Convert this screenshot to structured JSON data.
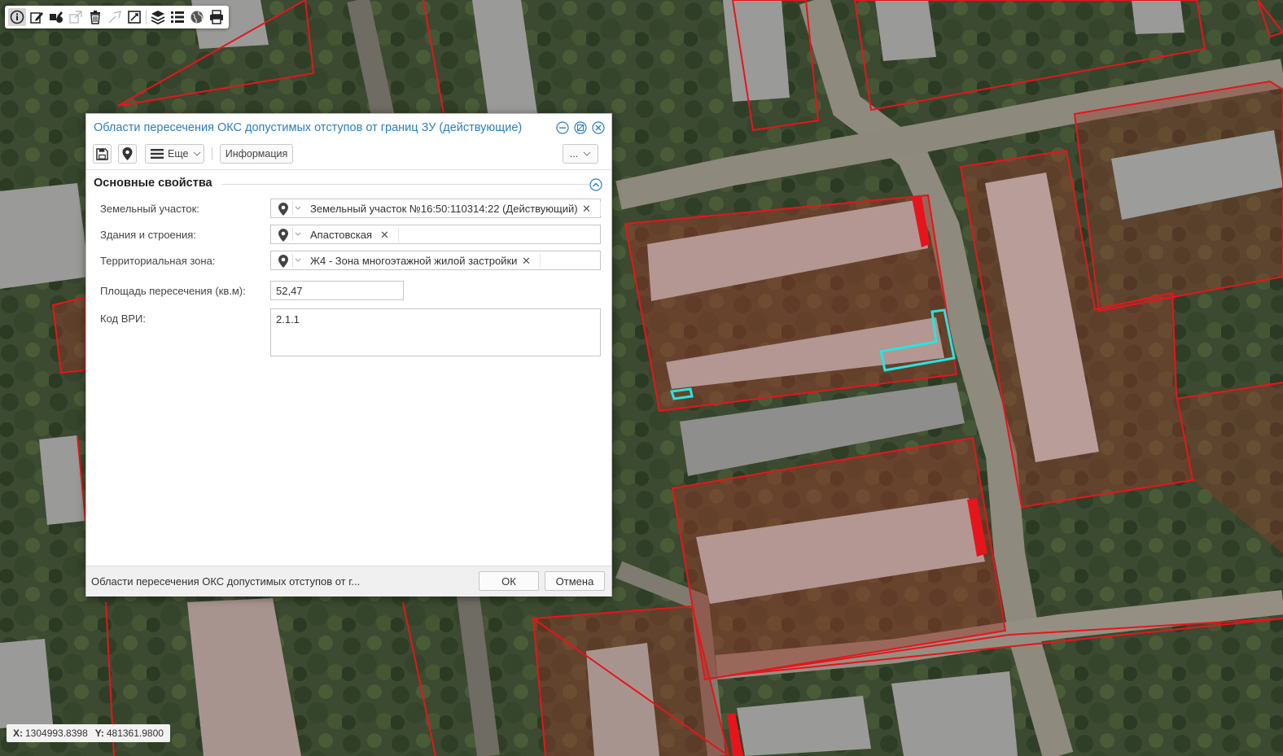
{
  "toolbar": {
    "tools": [
      {
        "name": "info-icon",
        "active": true
      },
      {
        "name": "edit-icon"
      },
      {
        "name": "edit-object-icon"
      },
      {
        "name": "edit-external-icon",
        "disabled": true
      },
      {
        "name": "delete-icon"
      },
      {
        "name": "measure-icon",
        "disabled": true
      },
      {
        "name": "edit-geometry-icon"
      },
      {
        "name": "layers-icon"
      },
      {
        "name": "list-icon"
      },
      {
        "name": "globe-icon"
      },
      {
        "name": "print-icon"
      }
    ]
  },
  "dialog": {
    "title": "Области пересечения ОКС допустимых отступов от границ ЗУ (действующие)",
    "toolbar": {
      "more_label": "Еще",
      "info_label": "Информация",
      "dots_label": "..."
    },
    "section_title": "Основные свойства",
    "fields": {
      "land_plot": {
        "label": "Земельный участок:",
        "value": "Земельный участок №16:50:110314:22 (Действующий)"
      },
      "buildings": {
        "label": "Здания и строения:",
        "value": "Апастовская"
      },
      "zone": {
        "label": "Территориальная зона:",
        "value": "Ж4 - Зона многоэтажной жилой застройки"
      },
      "area": {
        "label": "Площадь пересечения (кв.м):",
        "value": "52,47"
      },
      "vri_code": {
        "label": "Код ВРИ:",
        "value": "2.1.1"
      }
    },
    "footer": {
      "text": "Области пересечения ОКС допустимых отступов от г...",
      "ok_label": "ОК",
      "cancel_label": "Отмена"
    }
  },
  "status": {
    "x_label": "X:",
    "x_value": "1304993.8398",
    "y_label": "Y:",
    "y_value": "481361.9800"
  },
  "colors": {
    "parcel_border": "#e8141b",
    "selection_highlight": "#27e5e0",
    "title_text": "#2a7ec1"
  }
}
